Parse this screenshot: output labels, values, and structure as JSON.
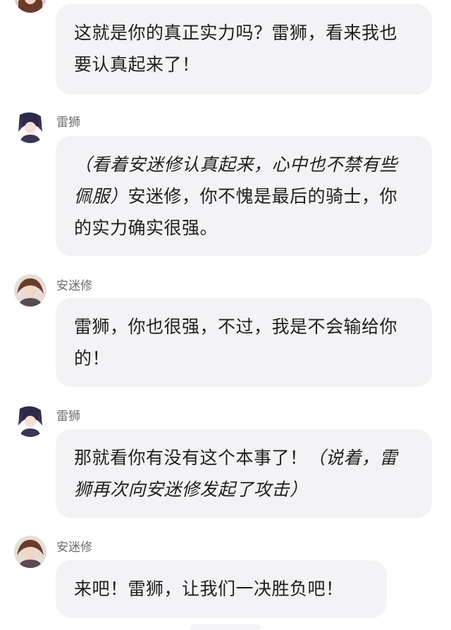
{
  "messages": [
    {
      "sender": "",
      "avatar": "avatar-anmixiu",
      "text": "这就是你的真正实力吗？雷狮，看来我也要认真起来了！"
    },
    {
      "sender": "雷狮",
      "avatar": "avatar-leishi",
      "action": "（看着安迷修认真起来，心中也不禁有些佩服）",
      "text": "安迷修，你不愧是最后的骑士，你的实力确实很强。"
    },
    {
      "sender": "安迷修",
      "avatar": "avatar-anmixiu",
      "text": "雷狮，你也很强，不过，我是不会输给你的！"
    },
    {
      "sender": "雷狮",
      "avatar": "avatar-leishi",
      "text": "那就看你有没有这个本事了！",
      "action": "（说着，雷狮再次向安迷修发起了攻击）"
    },
    {
      "sender": "安迷修",
      "avatar": "avatar-anmixiu",
      "text": "来吧！雷狮，让我们一决胜负吧！"
    }
  ],
  "colors": {
    "bubble": "#f3f3f5",
    "text": "#1f1f1f",
    "sender": "#6d6d6d"
  }
}
